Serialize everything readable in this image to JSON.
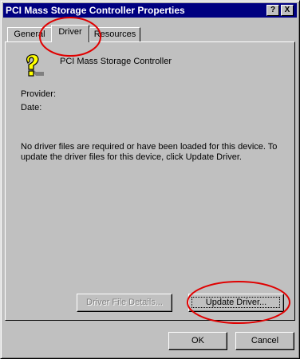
{
  "window": {
    "title": "PCI Mass Storage Controller Properties",
    "help_button": "?",
    "close_button": "X"
  },
  "tabs": [
    {
      "label": "General",
      "active": false
    },
    {
      "label": "Driver",
      "active": true
    },
    {
      "label": "Resources",
      "active": false
    }
  ],
  "driver_tab": {
    "device_name": "PCI Mass Storage Controller",
    "device_icon": "unknown-device-question-icon",
    "provider_label": "Provider:",
    "date_label": "Date:",
    "info_text": "No driver files are required or have been loaded for this device.  To update the driver files for this device, click Update Driver.",
    "driver_file_details_button": "Driver File Details...",
    "update_driver_button": "Update Driver..."
  },
  "footer": {
    "ok_button": "OK",
    "cancel_button": "Cancel"
  },
  "colors": {
    "face": "#c0c0c0",
    "titlebar": "#000080",
    "annotation": "#e00000"
  }
}
